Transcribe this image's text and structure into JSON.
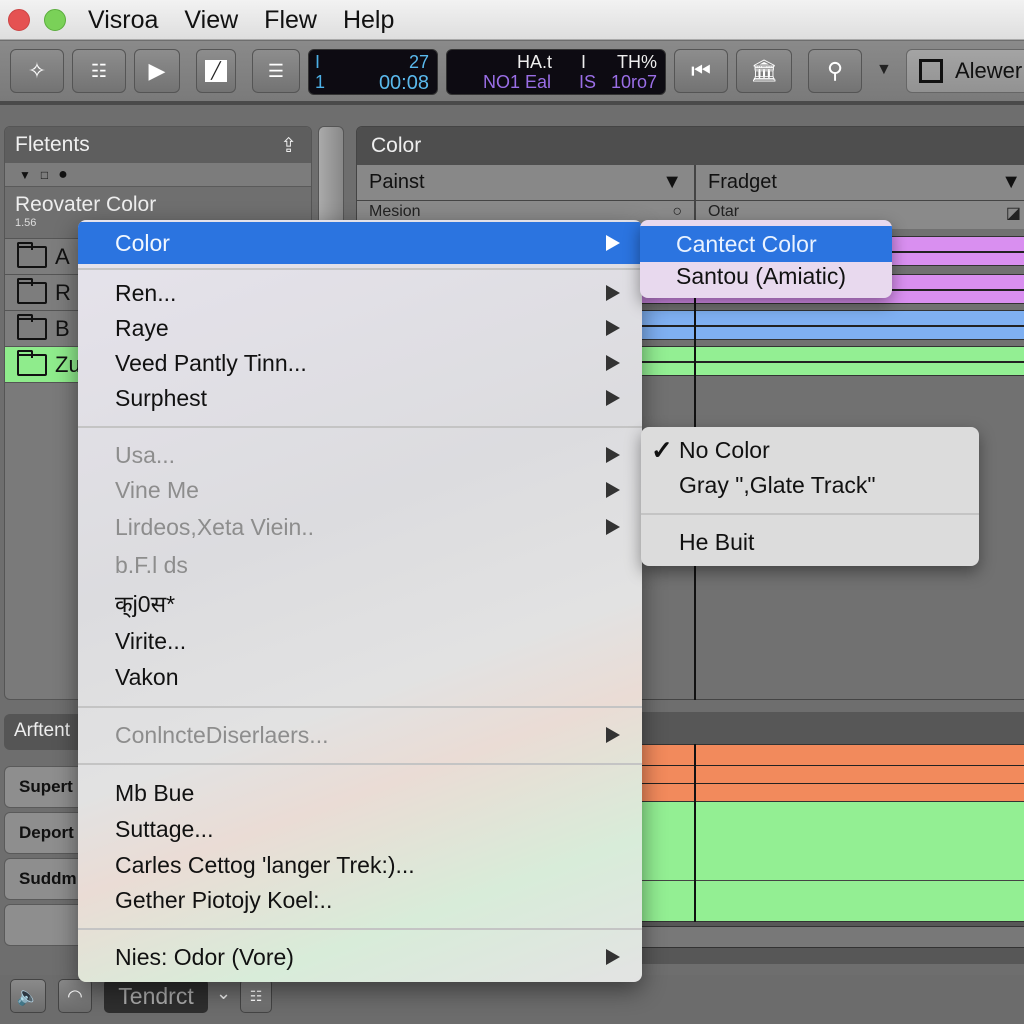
{
  "menubar": {
    "items": [
      "Visroa",
      "View",
      "Flew",
      "Help"
    ]
  },
  "toolbar": {
    "buttons": [
      "magic-wand",
      "mixer",
      "play",
      "edit",
      "list"
    ],
    "lcd1": {
      "top_left": "I",
      "top_right": "27",
      "bottom_left": "1",
      "bottom_right": "00:08"
    },
    "lcd2": {
      "top_mid": "HA.t",
      "top_sep": "I",
      "top_right": "TH%",
      "bottom_left": "NO1 Eal",
      "bottom_mid": "IS",
      "bottom_right": "10ro7"
    },
    "viewer_label": "Alewer"
  },
  "left_panel": {
    "title": "Fletents",
    "subtitle": "Reovater Color",
    "subtitle_small": "1.56",
    "rows": [
      {
        "label": "A",
        "active": false
      },
      {
        "label": "R",
        "active": false
      },
      {
        "label": "B",
        "active": false
      },
      {
        "label": "Zu",
        "active": true
      }
    ]
  },
  "color_panel": {
    "title": "Color",
    "dropdown1": "Painst",
    "dropdown2": "Fradget",
    "sub1": "Mesion",
    "sub2": "Otar",
    "track_colors": [
      "#d98ff0",
      "#d98ff0",
      "#7fb0f2",
      "#93ef93"
    ]
  },
  "bottom_left": {
    "header": "Arftent",
    "buttons": [
      "Supert",
      "Deport",
      "Suddm",
      ""
    ]
  },
  "bottom_bar": {
    "mode_label": "Tendrct"
  },
  "context_menu": {
    "items": [
      {
        "label": "Color",
        "submenu": true,
        "disabled": false,
        "highlight": true
      },
      {
        "label": "Ren...",
        "submenu": true,
        "disabled": false
      },
      {
        "label": "Raye",
        "submenu": true,
        "disabled": false
      },
      {
        "label": "Veed Pantly Tinn...",
        "submenu": true,
        "disabled": false
      },
      {
        "label": "Surphest",
        "submenu": true,
        "disabled": false
      },
      {
        "label": "Usa...",
        "submenu": true,
        "disabled": true
      },
      {
        "label": "Vine Me",
        "submenu": true,
        "disabled": true
      },
      {
        "label": "Lirdeos,Xeta Viein..",
        "submenu": true,
        "disabled": true
      },
      {
        "label": "b.F.l ds",
        "submenu": false,
        "disabled": true
      },
      {
        "label": "क्j0स*",
        "submenu": false,
        "disabled": false
      },
      {
        "label": "Virite...",
        "submenu": false,
        "disabled": false
      },
      {
        "label": "Vakon",
        "submenu": false,
        "disabled": false
      },
      {
        "label": "ConlncteDiserlaers...",
        "submenu": true,
        "disabled": true
      },
      {
        "label": "Mb Bue",
        "submenu": false,
        "disabled": false
      },
      {
        "label": "Suttage...",
        "submenu": false,
        "disabled": false
      },
      {
        "label": "Carles Cettog 'langer Trek:)...",
        "submenu": false,
        "disabled": false
      },
      {
        "label": "Gether Piotojy Koel:..",
        "submenu": false,
        "disabled": false
      },
      {
        "label": "Nies: Odor (Vore)",
        "submenu": true,
        "disabled": false
      }
    ]
  },
  "color_submenu": {
    "items": [
      "Cantect Color",
      "Santou (Amiatic)"
    ]
  },
  "track_color_submenu": {
    "items": [
      {
        "label": "No Color",
        "checked": true
      },
      {
        "label": "Gray \",Glate Track\"",
        "checked": false
      },
      {
        "label": "He Buit",
        "checked": false
      }
    ]
  },
  "colors": {
    "highlight": "#2b74e0",
    "active_green": "#8fec8c",
    "orange_lane": "#f28a5c",
    "green_lane": "#93ef93",
    "purple_lane": "#d98ff0",
    "blue_lane": "#7fb0f2"
  }
}
